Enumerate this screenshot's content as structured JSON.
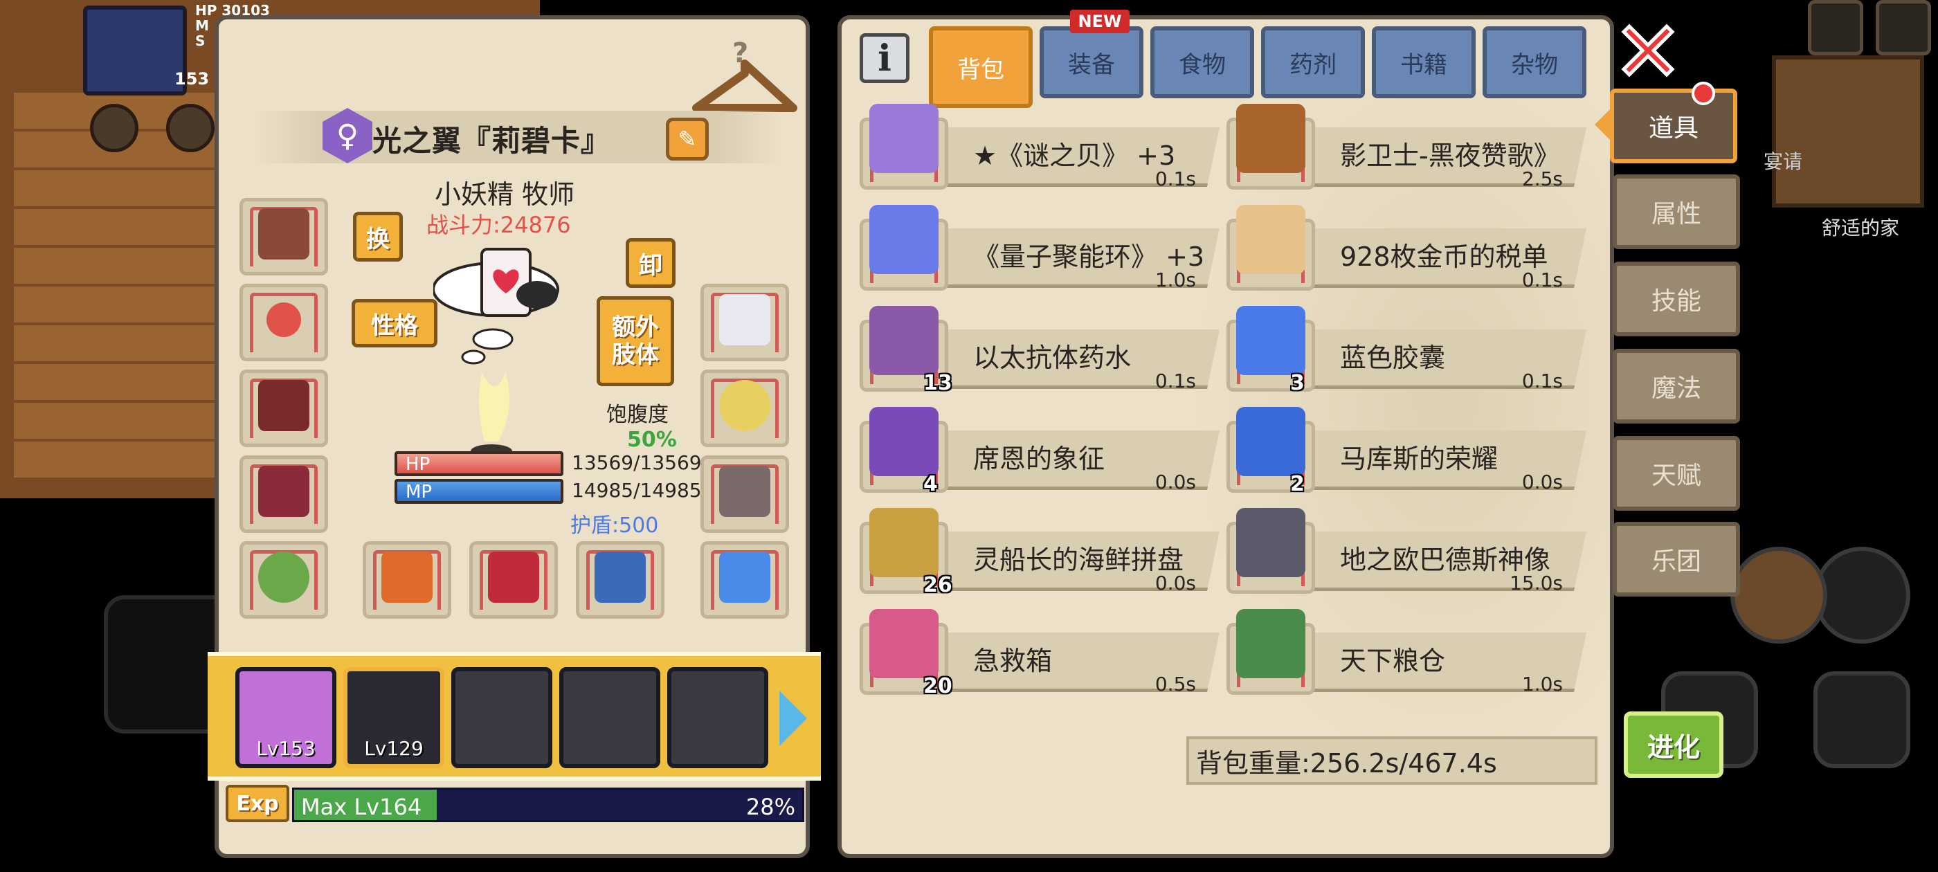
{
  "hud": {
    "stat_lines": [
      "HP",
      "M",
      "S"
    ],
    "hp_value": "30103",
    "level": "153"
  },
  "background": {
    "home_label": "舒适的家",
    "side_text": "宴请"
  },
  "character": {
    "name": "光之翼『莉碧卡』",
    "gender_symbol": "♀",
    "race_class": "小妖精 牧师",
    "combat_power": "战斗力:24876",
    "buttons": {
      "swap": "换",
      "unequip": "卸",
      "personality": "性格",
      "extra_limb": "额外肢体"
    },
    "satiety_label": "饱腹度",
    "satiety_value": "50%",
    "hp_label": "HP",
    "hp_value": "13569/13569",
    "mp_label": "MP",
    "mp_value": "14985/14985",
    "shield": "护盾:500",
    "team": [
      {
        "level": "Lv153",
        "color": "#c070d8"
      },
      {
        "level": "Lv129",
        "color": "#2a2a34"
      },
      {
        "level": "",
        "color": "#3a3a42"
      },
      {
        "level": "",
        "color": "#3a3a42"
      },
      {
        "level": "",
        "color": "#3a3a42"
      }
    ],
    "exp": {
      "badge": "Exp",
      "label": "Max Lv164",
      "percent": "28%",
      "fill_fraction": 0.28
    }
  },
  "inventory": {
    "tabs": [
      {
        "label": "背包",
        "active": true
      },
      {
        "label": "装备",
        "active": false,
        "badge": "NEW"
      },
      {
        "label": "食物",
        "active": false
      },
      {
        "label": "药剂",
        "active": false
      },
      {
        "label": "书籍",
        "active": false
      },
      {
        "label": "杂物",
        "active": false
      }
    ],
    "items": [
      {
        "name": "★《谜之贝》 +3",
        "weight": "0.1s",
        "qty": "",
        "icon": "shell-icon",
        "color": "#9a7ad8"
      },
      {
        "name": "影卫士-黑夜赞歌》",
        "weight": "2.5s",
        "qty": "",
        "icon": "armor-chest-icon",
        "color": "#a8642a"
      },
      {
        "name": "《量子聚能环》 +3",
        "weight": "1.0s",
        "qty": "",
        "icon": "device-icon",
        "color": "#6a7ae8"
      },
      {
        "name": "928枚金币的税单",
        "weight": "0.1s",
        "qty": "",
        "icon": "tax-bill-icon",
        "color": "#e8c08a"
      },
      {
        "name": "以太抗体药水",
        "weight": "0.1s",
        "qty": "13",
        "icon": "potion-icon",
        "color": "#8a5aa8"
      },
      {
        "name": "蓝色胶囊",
        "weight": "0.1s",
        "qty": "3",
        "icon": "capsule-icon",
        "color": "#4a7ae8"
      },
      {
        "name": "席恩的象征",
        "weight": "0.0s",
        "qty": "4",
        "icon": "purple-crystal-icon",
        "color": "#7a4ab8"
      },
      {
        "name": "马库斯的荣耀",
        "weight": "0.0s",
        "qty": "2",
        "icon": "blue-crystal-icon",
        "color": "#3a6ad8"
      },
      {
        "name": "灵船长的海鲜拼盘",
        "weight": "0.0s",
        "qty": "26",
        "icon": "seafood-platter-icon",
        "color": "#c8a040"
      },
      {
        "name": "地之欧巴德斯神像",
        "weight": "15.0s",
        "qty": "",
        "icon": "statue-icon",
        "color": "#5a5a6a"
      },
      {
        "name": "急救箱",
        "weight": "0.5s",
        "qty": "20",
        "icon": "first-aid-kit-icon",
        "color": "#d85a8a"
      },
      {
        "name": "天下粮仓",
        "weight": "1.0s",
        "qty": "",
        "icon": "grain-sack-icon",
        "color": "#4a8a4a"
      }
    ],
    "weight_summary": "背包重量:256.2s/467.4s"
  },
  "side_tabs": [
    {
      "label": "道具",
      "active": true
    },
    {
      "label": "属性",
      "active": false
    },
    {
      "label": "技能",
      "active": false
    },
    {
      "label": "魔法",
      "active": false
    },
    {
      "label": "天赋",
      "active": false
    },
    {
      "label": "乐团",
      "active": false
    }
  ],
  "evolve_label": "进化"
}
